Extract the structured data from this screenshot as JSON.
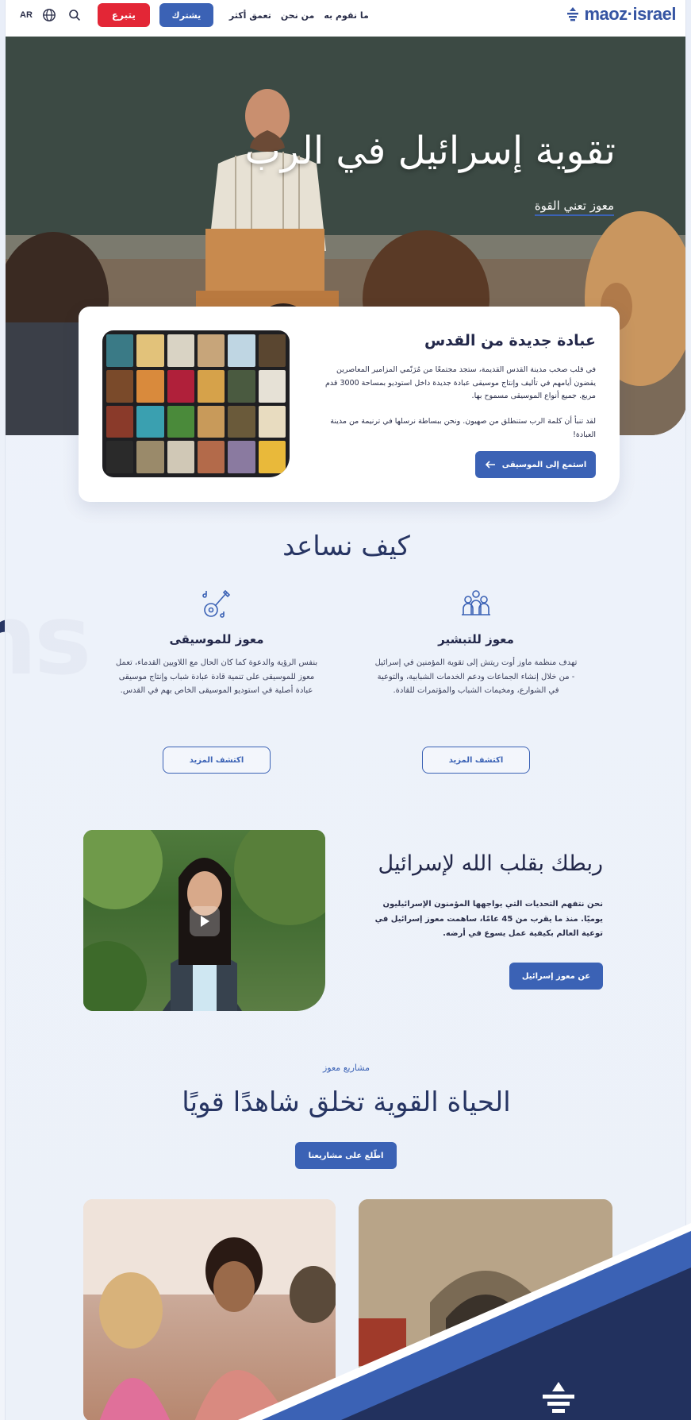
{
  "nav": {
    "lang": "AR",
    "donate": "يتبرع",
    "join": "يشترك",
    "links": [
      "ما نقوم به",
      "من نحن",
      "تعمق أكثر"
    ],
    "logo": "maoz·israel",
    "brand_color": "#3655a3",
    "donate_color": "#e32636"
  },
  "hero": {
    "title": "تقوية إسرائيل في الرب",
    "subtitle": "معوز تعني القوة"
  },
  "worship": {
    "title": "عبادة جديدة من القدس",
    "p1": "في قلب صخب مدينة القدس القديمة، ستجد مجتمعًا من مُرَنّمي المزامير المعاصرين يقضون أيامهم في تأليف وإنتاج موسيقى عبادة جديدة داخل استوديو بمساحة 3000 قدم مربع. جميع أنواع الموسيقى مسموح بها.",
    "p2": "لقد تنبأ أن كلمة الرب ستنطلق من صهيون. ونحن ببساطة نرسلها في ترنيمة من مدينة العبادة!",
    "button": "استمع إلى الموسيقى"
  },
  "help": {
    "title": "كيف نساعد",
    "evangelism": {
      "title": "معوز للتبشير",
      "text": "تهدف منظمة ماوز أوت ريتش إلى تقوية المؤمنين في إسرائيل - من خلال إنشاء الجماعات ودعم الخدمات الشبابية، والتوعية في الشوارع، ومخيمات الشباب والمؤتمرات للقادة.",
      "button": "اكتشف المزيد",
      "icon": "people-icon"
    },
    "music": {
      "title": "معوز للموسيقى",
      "text": "بنفس الرؤية والدعوة كما كان الحال مع اللاويين القدماء، تعمل معوز للموسيقى على تنمية قادة عبادة شباب وإنتاج موسيقى عبادة أصلية في استوديو الموسيقى الخاص بهم في القدس.",
      "button": "اكتشف المزيد",
      "icon": "guitar-icon"
    }
  },
  "connect": {
    "title": "ربطك بقلب الله لإسرائيل",
    "text": "نحن نتفهم التحديات التي يواجهها المؤمنون الإسرائيليون يوميًا. منذ ما يقرب من 45 عامًا، ساهمت معوز إسرائيل في توعية العالم بكيفية عمل يسوع في أرضه.",
    "button": "عن معوز إسرائيل"
  },
  "projects": {
    "kicker": "مشاريع معوز",
    "title": "الحياة القوية تخلق شاهدًا قويًا",
    "button": "اطّلع على مشاريعنا"
  },
  "background": {
    "word": "ns",
    "accent": "#3b62b5",
    "navy": "#22315e"
  }
}
